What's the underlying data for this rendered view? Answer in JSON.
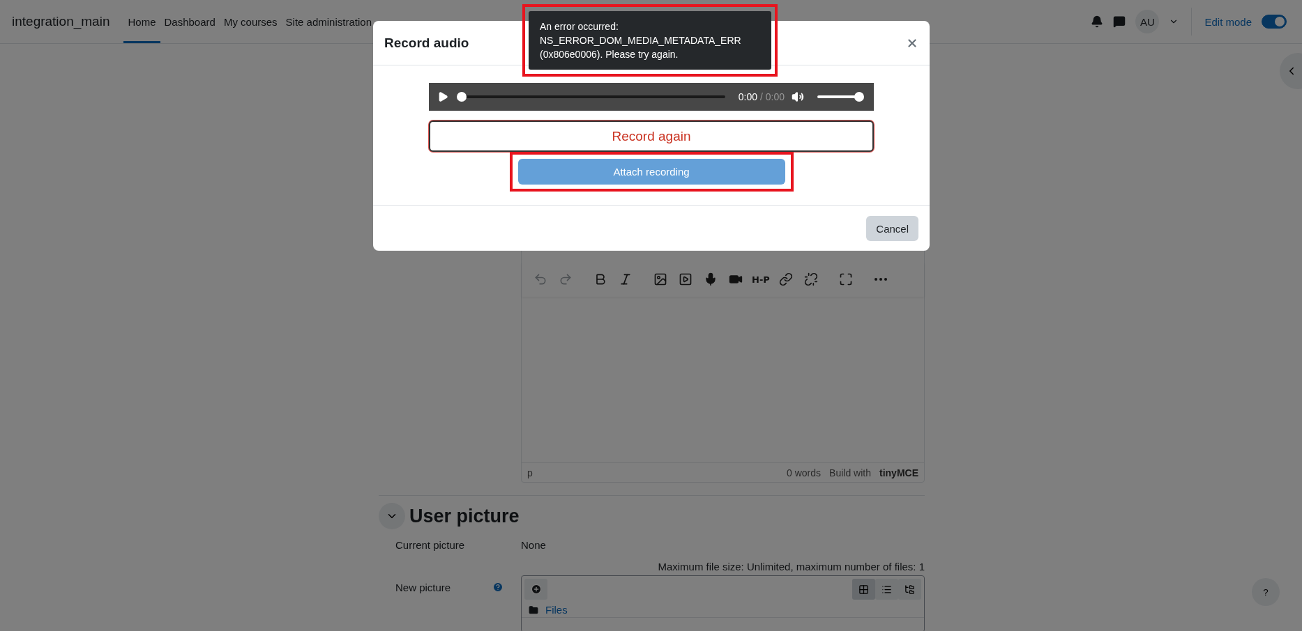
{
  "navbar": {
    "site_name": "integration_main",
    "items": [
      {
        "label": "Home",
        "selected": true
      },
      {
        "label": "Dashboard",
        "selected": false
      },
      {
        "label": "My courses",
        "selected": false
      },
      {
        "label": "Site administration",
        "selected": false
      }
    ],
    "avatar": "AU",
    "edit_mode": {
      "label": "Edit mode",
      "on": true
    }
  },
  "editor": {
    "toolbar": [
      {
        "kind": "undo",
        "disabled": true
      },
      {
        "kind": "redo",
        "disabled": true
      },
      {
        "kind": "bold",
        "disabled": false
      },
      {
        "kind": "italic",
        "disabled": false
      },
      {
        "kind": "image",
        "disabled": false
      },
      {
        "kind": "media",
        "disabled": false
      },
      {
        "kind": "microphone",
        "disabled": false
      },
      {
        "kind": "video",
        "disabled": false
      },
      {
        "kind": "h5p",
        "label": "H-P",
        "disabled": false
      },
      {
        "kind": "link",
        "disabled": false
      },
      {
        "kind": "unlink",
        "disabled": false
      },
      {
        "kind": "fullscreen",
        "disabled": false
      },
      {
        "kind": "more",
        "disabled": false
      }
    ],
    "status": {
      "path": "p",
      "words": "0 words",
      "branding": "Build with",
      "brand": "tinyMCE"
    }
  },
  "user_picture": {
    "title": "User picture",
    "expanded": true,
    "current_label": "Current picture",
    "current_value": "None",
    "new_label": "New picture",
    "limits": "Maximum file size: Unlimited, maximum number of files: 1",
    "views": [
      {
        "kind": "grid",
        "selected": true
      },
      {
        "kind": "list",
        "selected": false
      },
      {
        "kind": "tree",
        "selected": false
      }
    ],
    "folder": "Files"
  },
  "help_button": "?",
  "toast": {
    "lines": [
      "An error occurred:",
      "NS_ERROR_DOM_MEDIA_METADATA_ERR",
      "(0x806e0006). Please try again."
    ],
    "highlighted": true
  },
  "modal": {
    "title": "Record audio",
    "player": {
      "current": "0:00",
      "duration": "/ 0:00",
      "progress": {
        "level": 0
      },
      "volume": {
        "level": 1
      }
    },
    "record_again": "Record again",
    "attach": {
      "label": "Attach recording",
      "highlighted": true
    },
    "cancel": "Cancel"
  }
}
